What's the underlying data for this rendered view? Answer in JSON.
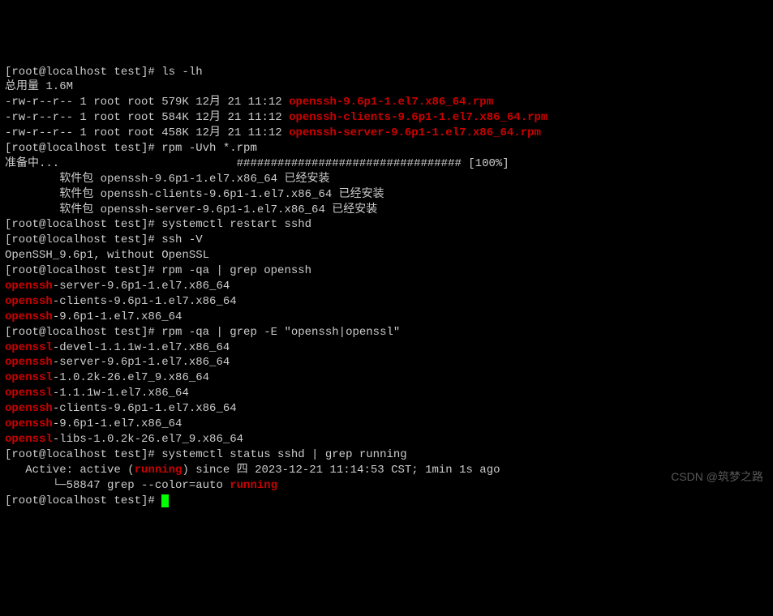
{
  "prompt": "[root@localhost test]# ",
  "cmd": {
    "ls": "ls -lh",
    "rpm_install": "rpm -Uvh *.rpm",
    "restart": "systemctl restart sshd",
    "sshv": "ssh -V",
    "rpmqa1": "rpm -qa | grep openssh",
    "rpmqa2": "rpm -qa | grep -E \"openssh|openssl\"",
    "status": "systemctl status sshd | grep running"
  },
  "ls_total": "总用量 1.6M",
  "ls_rows": [
    {
      "perm": "-rw-r--r-- 1 root root 579K 12月 21 11:12 ",
      "file": "openssh-9.6p1-1.el7.x86_64.rpm"
    },
    {
      "perm": "-rw-r--r-- 1 root root 584K 12月 21 11:12 ",
      "file": "openssh-clients-9.6p1-1.el7.x86_64.rpm"
    },
    {
      "perm": "-rw-r--r-- 1 root root 458K 12月 21 11:12 ",
      "file": "openssh-server-9.6p1-1.el7.x86_64.rpm"
    }
  ],
  "rpm_prep": "准备中...                          ################################# [100%]",
  "rpm_installed": [
    "        软件包 openssh-9.6p1-1.el7.x86_64 已经安装",
    "        软件包 openssh-clients-9.6p1-1.el7.x86_64 已经安装",
    "        软件包 openssh-server-9.6p1-1.el7.x86_64 已经安装"
  ],
  "ssh_version": "OpenSSH_9.6p1, without OpenSSL",
  "grep_openssh": [
    {
      "hl": "openssh",
      "rest": "-server-9.6p1-1.el7.x86_64"
    },
    {
      "hl": "openssh",
      "rest": "-clients-9.6p1-1.el7.x86_64"
    },
    {
      "hl": "openssh",
      "rest": "-9.6p1-1.el7.x86_64"
    }
  ],
  "grep_both": [
    {
      "hl": "openssl",
      "rest": "-devel-1.1.1w-1.el7.x86_64"
    },
    {
      "hl": "openssh",
      "rest": "-server-9.6p1-1.el7.x86_64"
    },
    {
      "hl": "openssl",
      "rest": "-1.0.2k-26.el7_9.x86_64"
    },
    {
      "hl": "openssl",
      "rest": "-1.1.1w-1.el7.x86_64"
    },
    {
      "hl": "openssh",
      "rest": "-clients-9.6p1-1.el7.x86_64"
    },
    {
      "hl": "openssh",
      "rest": "-9.6p1-1.el7.x86_64"
    },
    {
      "hl": "openssl",
      "rest": "-libs-1.0.2k-26.el7_9.x86_64"
    }
  ],
  "status_out": {
    "pre1": "   Active: active (",
    "hl1": "running",
    "mid1": ") since 四 2023-12-21 11:14:53 CST; 1min 1s ago",
    "pre2": "       └─58847 grep --color=auto ",
    "hl2": "running"
  },
  "watermark": "CSDN @筑梦之路"
}
